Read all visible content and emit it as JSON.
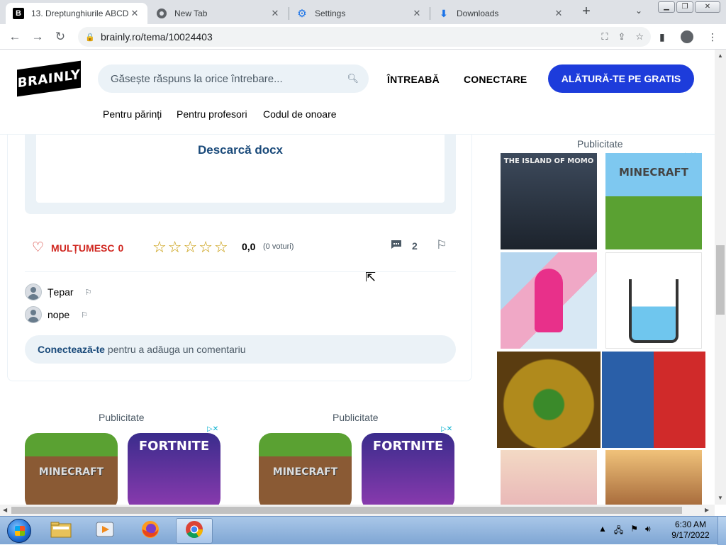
{
  "browser": {
    "tabs": [
      {
        "title": "13. Dreptunghiurile ABCD",
        "favicon": "B",
        "active": true
      },
      {
        "title": "New Tab",
        "favicon": "chrome-icon",
        "active": false
      },
      {
        "title": "Settings",
        "favicon": "gear-icon",
        "active": false
      },
      {
        "title": "Downloads",
        "favicon": "download-icon",
        "active": false
      }
    ],
    "url": "brainly.ro/tema/10024403"
  },
  "header": {
    "logo": "BRAINLY",
    "search_placeholder": "Găsește răspuns la orice întrebare...",
    "ask": "ÎNTREABĂ",
    "login": "CONECTARE",
    "join": "ALĂTURĂ-TE PE GRATIS",
    "subnav": [
      "Pentru părinți",
      "Pentru profesori",
      "Codul de onoare"
    ]
  },
  "answer": {
    "download": "Descarcă docx",
    "thanks": "MULȚUMESC",
    "thanks_count": "0",
    "rating": "0,0",
    "votes": "(0 voturi)",
    "comment_count": "2",
    "comments": [
      {
        "author": "Țepar"
      },
      {
        "author": "nope"
      }
    ],
    "login_bold": "Conectează-te",
    "login_rest": "pentru a adăuga un comentariu"
  },
  "ads": {
    "label": "Publicitate",
    "bottom_tiles": [
      "MINECRAFT",
      "FORTNITE",
      "MINECRAFT",
      "FORTNITE"
    ],
    "right_tiles": [
      "THE ISLAND OF MOMO",
      "MINECRAFT",
      "",
      "",
      "",
      "",
      "",
      ""
    ]
  },
  "taskbar": {
    "time": "6:30 AM",
    "date": "9/17/2022"
  },
  "colors": {
    "brand_blue": "#1d3cdb",
    "link_blue": "#1a4a7a",
    "thanks_red": "#d0261f",
    "star_gold": "#c69800",
    "soft_bg": "#ebf2f7"
  }
}
